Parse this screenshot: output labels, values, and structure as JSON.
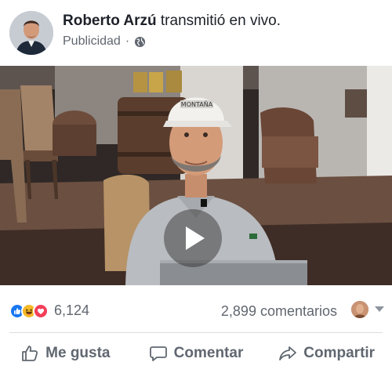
{
  "post": {
    "author": "Roberto Arzú",
    "action": "transmitió en vivo.",
    "sponsored_label": "Publicidad",
    "separator": "·",
    "privacy_icon": "globe-icon"
  },
  "video": {
    "play_icon": "play-icon",
    "cap_text": "MONTAÑA"
  },
  "stats": {
    "reaction_icons": [
      "like-icon",
      "haha-icon",
      "love-icon"
    ],
    "reaction_count": "6,124",
    "comments_text": "2,899 comentarios"
  },
  "actions": {
    "like_label": "Me gusta",
    "comment_label": "Comentar",
    "share_label": "Compartir"
  },
  "colors": {
    "like_blue": "#1877f2",
    "haha_yellow": "#f7b928",
    "love_red": "#f33e58",
    "secondary_text": "#606770"
  }
}
